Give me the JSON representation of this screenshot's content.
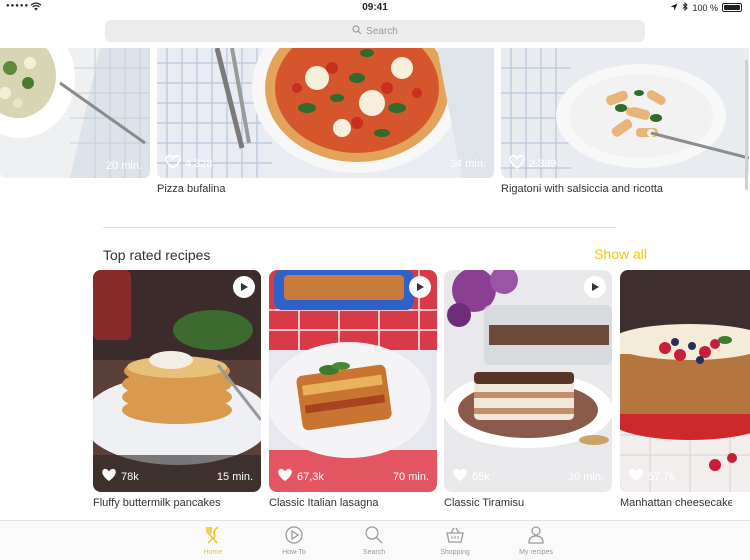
{
  "status_bar": {
    "time": "09:41",
    "battery_text": "100 %",
    "battery_level": 1.0
  },
  "search": {
    "placeholder": "Search"
  },
  "top_carousel": [
    {
      "title": "",
      "likes": "",
      "time": "20 min."
    },
    {
      "title": "Pizza bufalina",
      "likes": "4.328",
      "time": "34 min."
    },
    {
      "title": "Rigatoni with salsiccia and ricotta",
      "likes": "2.339",
      "time": ""
    }
  ],
  "section": {
    "title": "Top rated recipes",
    "show_all": "Show all"
  },
  "top_rated": [
    {
      "title": "Fluffy buttermilk pancakes",
      "likes": "78k",
      "time": "15 min."
    },
    {
      "title": "Classic Italian lasagna",
      "likes": "67,3k",
      "time": "70 min."
    },
    {
      "title": "Classic Tiramisu",
      "likes": "65k",
      "time": "30 min."
    },
    {
      "title": "Manhattan cheesecake",
      "likes": "57,7k",
      "time": ""
    }
  ],
  "tabs": [
    {
      "label": "Home",
      "icon": "fork-knife-icon",
      "active": true
    },
    {
      "label": "How-To",
      "icon": "play-circle-icon",
      "active": false
    },
    {
      "label": "Search",
      "icon": "search-icon",
      "active": false
    },
    {
      "label": "Shopping",
      "icon": "basket-icon",
      "active": false
    },
    {
      "label": "My recipes",
      "icon": "person-icon",
      "active": false
    }
  ],
  "colors": {
    "accent": "#f0c419",
    "inactive": "#9a9a9a"
  }
}
